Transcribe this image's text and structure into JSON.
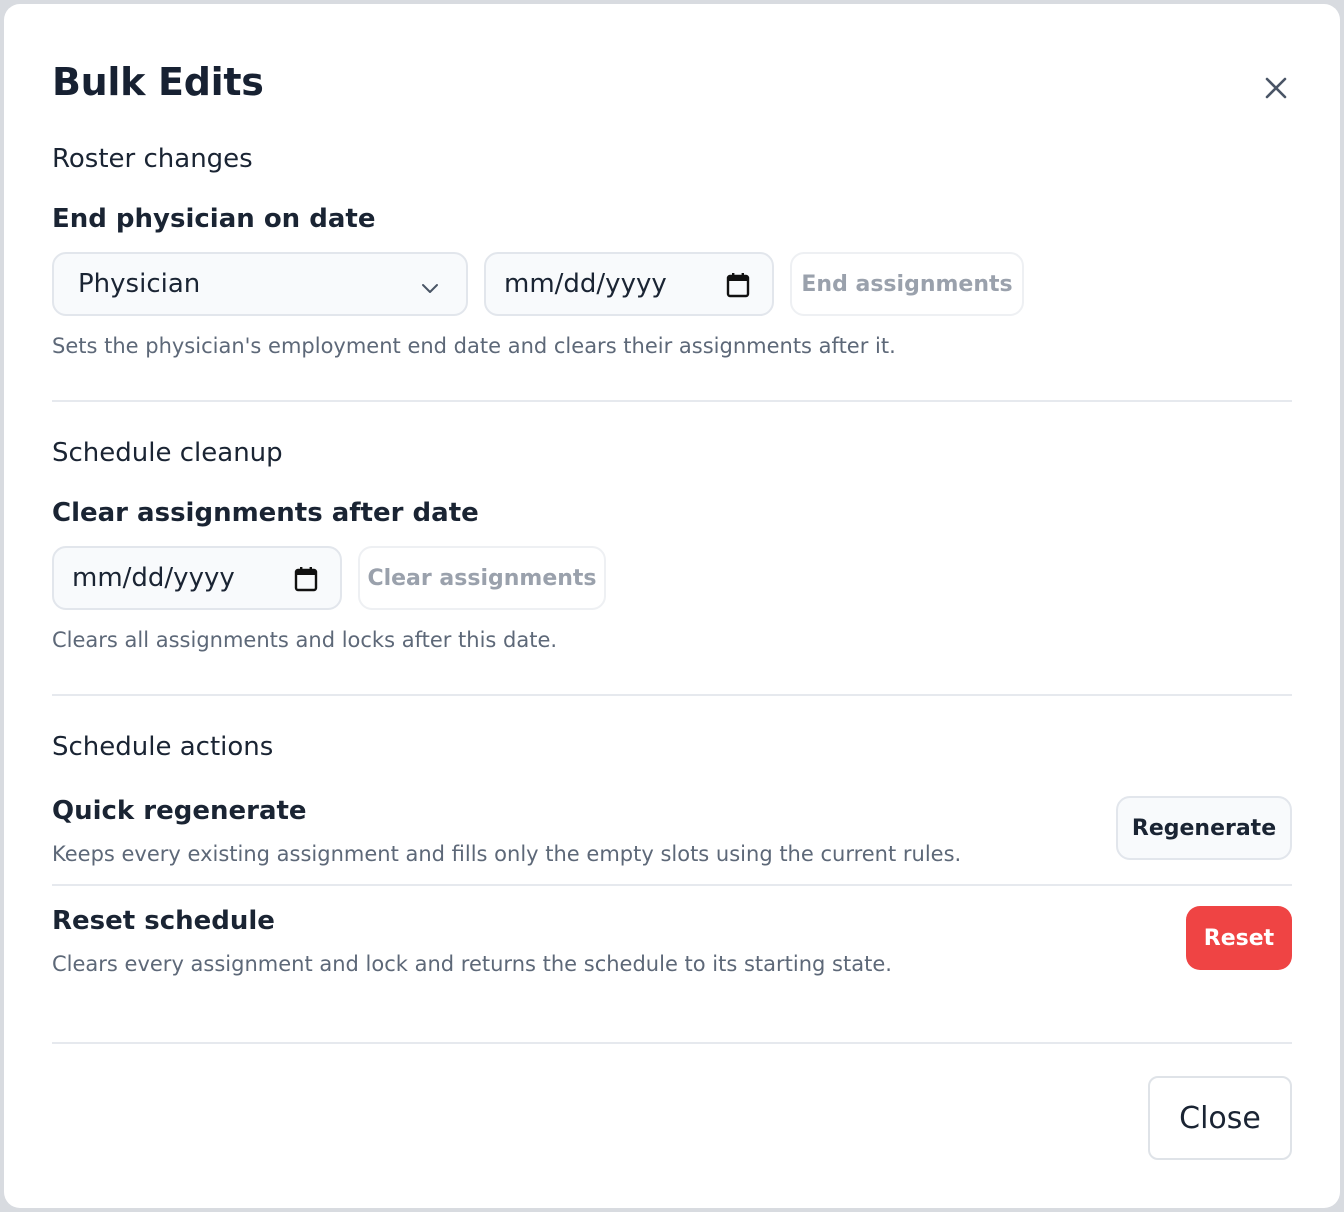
{
  "dialog": {
    "title": "Bulk Edits",
    "close_button_label": "Close"
  },
  "roster": {
    "section_title": "Roster changes",
    "field_label": "End physician on date",
    "physician_select": {
      "selected": "Physician"
    },
    "date_input": {
      "placeholder": "mm/dd/yyyy"
    },
    "action_label": "End assignments",
    "help": "Sets the physician's employment end date and clears their assignments after it."
  },
  "cleanup": {
    "section_title": "Schedule cleanup",
    "field_label": "Clear assignments after date",
    "date_input": {
      "placeholder": "mm/dd/yyyy"
    },
    "action_label": "Clear assignments",
    "help": "Clears all assignments and locks after this date."
  },
  "actions": {
    "section_title": "Schedule actions",
    "items": [
      {
        "label": "Quick regenerate",
        "description": "Keeps every existing assignment and fills only the empty slots using the current rules.",
        "button": "Regenerate"
      },
      {
        "label": "Reset schedule",
        "description": "Clears every assignment and lock and returns the schedule to its starting state.",
        "button": "Reset"
      }
    ]
  },
  "icons": {
    "close": "close-icon",
    "chevron": "chevron-down-icon",
    "calendar": "calendar-icon"
  },
  "colors": {
    "danger": "#ef4444",
    "text": "#1a2433",
    "muted": "#5d6878",
    "disabled_text": "#9aa1ac"
  }
}
